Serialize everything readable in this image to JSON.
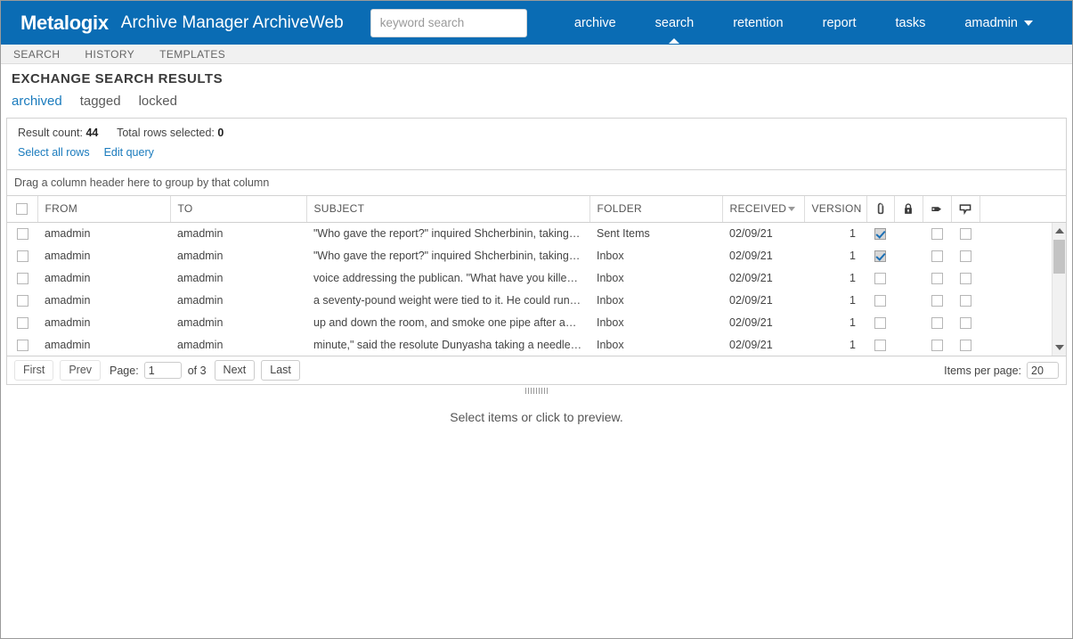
{
  "header": {
    "brand": "Metalogix",
    "app_title": "Archive Manager ArchiveWeb",
    "bar_color": "#0a6cb4",
    "search": {
      "placeholder": "keyword search",
      "value": ""
    },
    "nav": [
      {
        "label": "archive",
        "active": false
      },
      {
        "label": "search",
        "active": true
      },
      {
        "label": "retention",
        "active": false
      },
      {
        "label": "report",
        "active": false
      },
      {
        "label": "tasks",
        "active": false
      }
    ],
    "user": {
      "label": "amadmin",
      "caret": "chevron-down-icon"
    }
  },
  "subnav": {
    "items": [
      {
        "label": "SEARCH"
      },
      {
        "label": "HISTORY"
      },
      {
        "label": "TEMPLATES"
      }
    ]
  },
  "page": {
    "title": "EXCHANGE SEARCH RESULTS",
    "filter_tabs": [
      {
        "label": "archived",
        "selected": true
      },
      {
        "label": "tagged",
        "selected": false
      },
      {
        "label": "locked",
        "selected": false
      }
    ]
  },
  "results": {
    "result_count_label": "Result count:",
    "result_count_value": "44",
    "rows_selected_label": "Total rows selected:",
    "rows_selected_value": "0",
    "actions": [
      {
        "label": "Select all rows"
      },
      {
        "label": "Edit query"
      }
    ],
    "group_hint": "Drag a column header here to group by that column"
  },
  "grid": {
    "columns": [
      {
        "key": "select",
        "label": "",
        "type": "checkbox",
        "icon": "checkbox-icon"
      },
      {
        "key": "from",
        "label": "FROM",
        "type": "text"
      },
      {
        "key": "to",
        "label": "TO",
        "type": "text"
      },
      {
        "key": "subject",
        "label": "SUBJECT",
        "type": "text"
      },
      {
        "key": "folder",
        "label": "FOLDER",
        "type": "text"
      },
      {
        "key": "received",
        "label": "RECEIVED",
        "type": "text",
        "sort": "desc"
      },
      {
        "key": "version",
        "label": "VERSION",
        "type": "text"
      },
      {
        "key": "attachment",
        "label": "",
        "type": "icon",
        "icon": "paperclip-icon"
      },
      {
        "key": "locked",
        "label": "",
        "type": "icon",
        "icon": "lock-icon"
      },
      {
        "key": "tag",
        "label": "",
        "type": "icon",
        "icon": "tag-icon"
      },
      {
        "key": "note",
        "label": "",
        "type": "icon",
        "icon": "comment-icon"
      },
      {
        "key": "spacer",
        "label": "",
        "type": "spacer"
      }
    ],
    "rows": [
      {
        "selected": false,
        "from": "amadmin",
        "to": "amadmin",
        "subject": "\"Who gave the report?\" inquired Shcherbinin, taking the ...",
        "folder": "Sent Items",
        "received": "02/09/21",
        "version": "1",
        "attachment": true,
        "tag": false,
        "note": false
      },
      {
        "selected": false,
        "from": "amadmin",
        "to": "amadmin",
        "subject": "\"Who gave the report?\" inquired Shcherbinin, taking the ...",
        "folder": "Inbox",
        "received": "02/09/21",
        "version": "1",
        "attachment": true,
        "tag": false,
        "note": false
      },
      {
        "selected": false,
        "from": "amadmin",
        "to": "amadmin",
        "subject": "voice addressing the publican. \"What have you killed a ...",
        "folder": "Inbox",
        "received": "02/09/21",
        "version": "1",
        "attachment": false,
        "tag": false,
        "note": false
      },
      {
        "selected": false,
        "from": "amadmin",
        "to": "amadmin",
        "subject": "a seventy-pound weight were tied to it. He could run no ...",
        "folder": "Inbox",
        "received": "02/09/21",
        "version": "1",
        "attachment": false,
        "tag": false,
        "note": false
      },
      {
        "selected": false,
        "from": "amadmin",
        "to": "amadmin",
        "subject": "up and down the room, and smoke one pipe after anoth...",
        "folder": "Inbox",
        "received": "02/09/21",
        "version": "1",
        "attachment": false,
        "tag": false,
        "note": false
      },
      {
        "selected": false,
        "from": "amadmin",
        "to": "amadmin",
        "subject": "minute,\" said the resolute Dunyasha taking a needle that...",
        "folder": "Inbox",
        "received": "02/09/21",
        "version": "1",
        "attachment": false,
        "tag": false,
        "note": false
      }
    ]
  },
  "pager": {
    "first": "First",
    "prev": "Prev",
    "page_label": "Page:",
    "page_value": "1",
    "of_label": "of 3",
    "next": "Next",
    "last": "Last",
    "items_per_page_label": "Items per page:",
    "items_per_page_value": "20"
  },
  "preview": {
    "message": "Select items or click to preview."
  }
}
